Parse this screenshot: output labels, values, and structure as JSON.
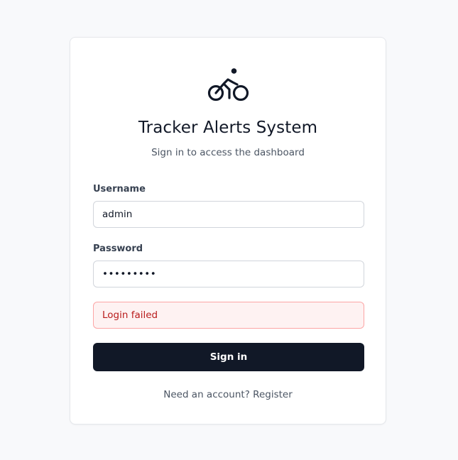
{
  "app": {
    "title": "Tracker Alerts System",
    "subtitle": "Sign in to access the dashboard",
    "logo_icon": "bicycle-icon"
  },
  "form": {
    "username_label": "Username",
    "username_value": "admin",
    "password_label": "Password",
    "password_value": "passwords",
    "error_message": "Login failed",
    "submit_label": "Sign in"
  },
  "footer": {
    "prompt": "Need an account?",
    "register_link": "Register"
  },
  "colors": {
    "background": "#f8f9fb",
    "primary_button": "#111827",
    "error_text": "#b91c1c",
    "error_background": "#fef2f2",
    "error_border": "#fca5a5"
  }
}
